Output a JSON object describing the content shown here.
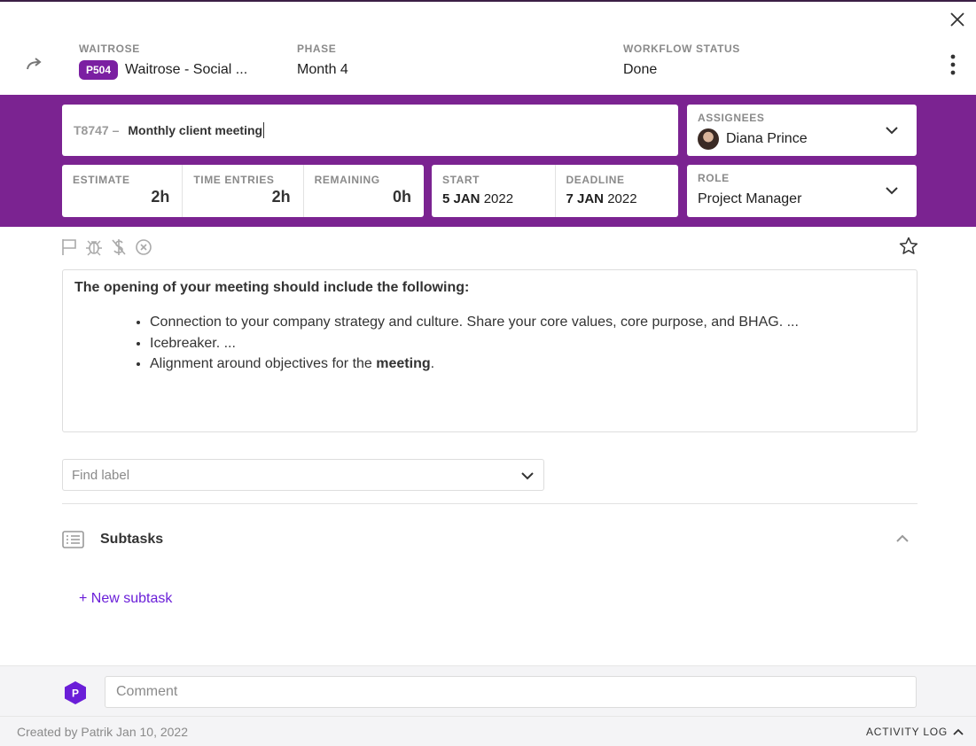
{
  "header": {
    "client_label": "WAITROSE",
    "project_badge": "P504",
    "project_name": "Waitrose - Social ...",
    "phase_label": "PHASE",
    "phase_value": "Month 4",
    "status_label": "WORKFLOW STATUS",
    "status_value": "Done"
  },
  "task": {
    "id": "T8747",
    "id_separator": "–",
    "title": "Monthly client meeting"
  },
  "assignees": {
    "label": "ASSIGNEES",
    "name": "Diana Prince"
  },
  "estimates": {
    "estimate_label": "ESTIMATE",
    "estimate_value": "2h",
    "time_entries_label": "TIME ENTRIES",
    "time_entries_value": "2h",
    "remaining_label": "REMAINING",
    "remaining_value": "0h"
  },
  "dates": {
    "start_label": "START",
    "start_day_month": "5 JAN",
    "start_year": "2022",
    "deadline_label": "DEADLINE",
    "deadline_day_month": "7 JAN",
    "deadline_year": "2022"
  },
  "role": {
    "label": "ROLE",
    "value": "Project Manager"
  },
  "description": {
    "heading": "The opening of your meeting should include the following:",
    "bullet1": "Connection to your company strategy and culture. Share your core values, core purpose, and BHAG. ...",
    "bullet2": "Icebreaker. ...",
    "bullet3_prefix": "Alignment around objectives for the ",
    "bullet3_bold": "meeting",
    "bullet3_suffix": "."
  },
  "labels": {
    "placeholder": "Find label"
  },
  "subtasks": {
    "label": "Subtasks",
    "new_label": "+ New subtask"
  },
  "comment": {
    "avatar_initial": "P",
    "placeholder": "Comment"
  },
  "footer": {
    "created": "Created by Patrik Jan 10, 2022",
    "activity_log": "ACTIVITY LOG"
  },
  "colors": {
    "brand_purple": "#7b2391",
    "badge_purple": "#7b1fa2",
    "link_purple": "#6a1ed8"
  },
  "icons": [
    "close-icon",
    "redirect-arrow-icon",
    "kebab-menu-icon",
    "chevron-down-icon",
    "flag-icon",
    "bug-icon",
    "no-billing-icon",
    "blocked-icon",
    "star-icon",
    "list-icon",
    "chevron-up-icon"
  ]
}
